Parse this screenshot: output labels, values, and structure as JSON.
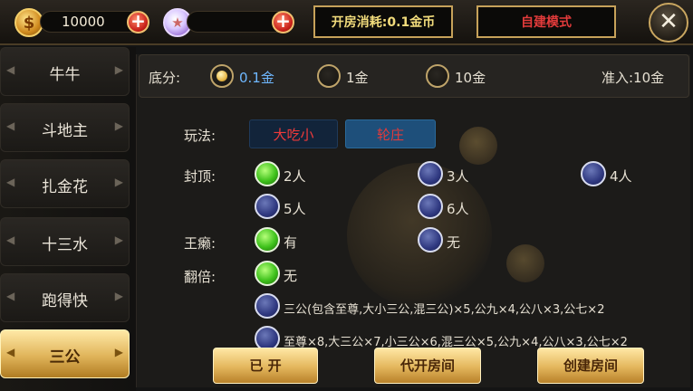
{
  "header": {
    "gold_icon": "gold-coin-icon",
    "gold_amount": "10000",
    "diamond_icon": "diamond-icon",
    "diamond_amount": "",
    "room_fee": "开房消耗:0.1金币",
    "mode": "自建模式",
    "close_icon": "close-icon"
  },
  "sidebar": {
    "items": [
      {
        "label": "牛牛",
        "active": false
      },
      {
        "label": "斗地主",
        "active": false
      },
      {
        "label": "扎金花",
        "active": false
      },
      {
        "label": "十三水",
        "active": false
      },
      {
        "label": "跑得快",
        "active": false
      },
      {
        "label": "三公",
        "active": true
      }
    ]
  },
  "base_score": {
    "label": "底分:",
    "options": [
      "0.1金",
      "1金",
      "10金"
    ],
    "selected": "0.1金",
    "entry": "准入:10金"
  },
  "play_mode": {
    "label": "玩法:",
    "tabs": [
      "大吃小",
      "轮庄"
    ],
    "selected": "大吃小"
  },
  "cap": {
    "label": "封顶:",
    "options": [
      "2人",
      "3人",
      "4人",
      "5人",
      "6人"
    ],
    "selected": "2人"
  },
  "wild": {
    "label": "王癞:",
    "options": [
      "有",
      "无"
    ],
    "selected": "有"
  },
  "double": {
    "label": "翻倍:",
    "options": [
      "无",
      "三公(包含至尊,大小三公,混三公)×5,公九×4,公八×3,公七×2",
      "至尊×8,大三公×7,小三公×6,混三公×5,公九×4,公八×3,公七×2"
    ],
    "selected": "无"
  },
  "actions": {
    "opened": "已 开",
    "proxy": "代开房间",
    "create": "创建房间"
  },
  "colors": {
    "accent_gold": "#e3b65c",
    "selected_green": "#3fc21c",
    "unselected_blue": "#2f3880",
    "tab_red": "#f03a3a"
  }
}
